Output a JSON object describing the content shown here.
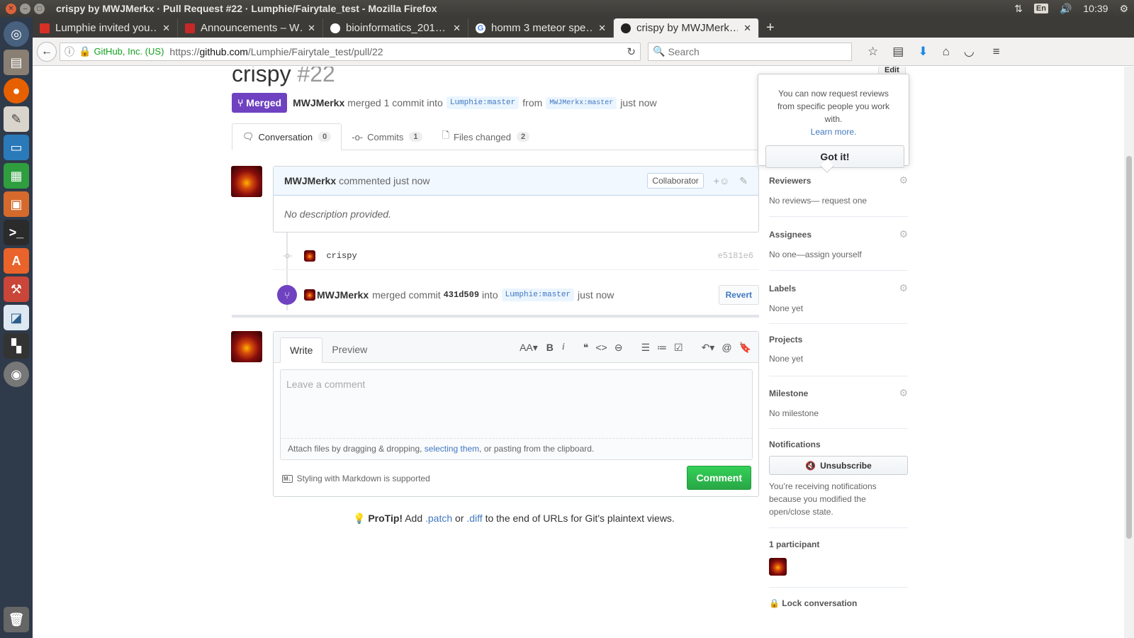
{
  "window": {
    "title": "crispy by MWJMerkx · Pull Request #22 · Lumphie/Fairytale_test - Mozilla Firefox"
  },
  "tray": {
    "lang": "En",
    "time": "10:39"
  },
  "launcher": {
    "icons": [
      "ubuntu-dash-icon",
      "files-icon",
      "firefox-icon",
      "text-editor-icon",
      "writer-icon",
      "calc-icon",
      "impress-icon",
      "terminal-icon",
      "software-center-icon",
      "settings-icon",
      "workbench-icon",
      "workspace-icon",
      "dvd-icon",
      "trash-icon"
    ]
  },
  "tabs": [
    {
      "label": "Lumphie invited you…",
      "icon": "gmail-icon",
      "color": "#d93025"
    },
    {
      "label": "Announcements – W…",
      "icon": "puzzle-icon",
      "color": "#c62828"
    },
    {
      "label": "bioinformatics_201…",
      "icon": "github-icon",
      "color": "#333333"
    },
    {
      "label": "homm 3 meteor spe…",
      "icon": "google-icon",
      "color": "#4285f4"
    },
    {
      "label": "crispy by MWJMerk…",
      "icon": "github-icon",
      "color": "#333333",
      "active": true
    }
  ],
  "nav": {
    "identity": "GitHub, Inc. (US)",
    "url_prefix": "https://",
    "url_host": "github.com",
    "url_path": "/Lumphie/Fairytale_test/pull/22",
    "search_placeholder": "Search"
  },
  "pr": {
    "title": "crispy",
    "number": "#22",
    "edit": "Edit",
    "state": "Merged",
    "author": "MWJMerkx",
    "action": "merged 1 commit into",
    "base": "Lumphie:master",
    "from": "from",
    "head": "MWJMerkx:master",
    "time": "just now"
  },
  "pr_tabs": [
    {
      "label": "Conversation",
      "count": "0",
      "icon": "comment-icon"
    },
    {
      "label": "Commits",
      "count": "1",
      "icon": "commit-icon"
    },
    {
      "label": "Files changed",
      "count": "2",
      "icon": "file-diff-icon"
    }
  ],
  "comment": {
    "author": "MWJMerkx",
    "meta": "commented just now",
    "badge": "Collaborator",
    "body": "No description provided."
  },
  "commit": {
    "message": "crispy",
    "sha": "e5181e6"
  },
  "merge_event": {
    "author": "MWJMerkx",
    "text1": "merged commit",
    "sha": "431d509",
    "text2": "into",
    "branch": "Lumphie:master",
    "time": "just now",
    "revert": "Revert"
  },
  "new_comment": {
    "write": "Write",
    "preview": "Preview",
    "placeholder": "Leave a comment",
    "attach_1": "Attach files by dragging & dropping, ",
    "attach_link": "selecting them",
    "attach_2": ", or pasting from the clipboard.",
    "markdown": "Styling with Markdown is supported",
    "submit": "Comment"
  },
  "protip": {
    "label": "ProTip!",
    "t1": " Add ",
    "patch": ".patch",
    "t2": " or ",
    "diff": ".diff",
    "t3": " to the end of URLs for Git's plaintext views."
  },
  "popover": {
    "text": "You can now request reviews from specific people you work with.",
    "link": "Learn more.",
    "button": "Got it!"
  },
  "sidebar": {
    "reviewers": {
      "title": "Reviewers",
      "value": "No reviews— request one"
    },
    "assignees": {
      "title": "Assignees",
      "value": "No one—assign yourself"
    },
    "labels": {
      "title": "Labels",
      "value": "None yet"
    },
    "projects": {
      "title": "Projects",
      "value": "None yet"
    },
    "milestone": {
      "title": "Milestone",
      "value": "No milestone"
    },
    "notifications": {
      "title": "Notifications",
      "button": "Unsubscribe",
      "note": "You’re receiving notifications because you modified the open/close state."
    },
    "participants": {
      "title": "1 participant"
    },
    "lock": "Lock conversation"
  }
}
